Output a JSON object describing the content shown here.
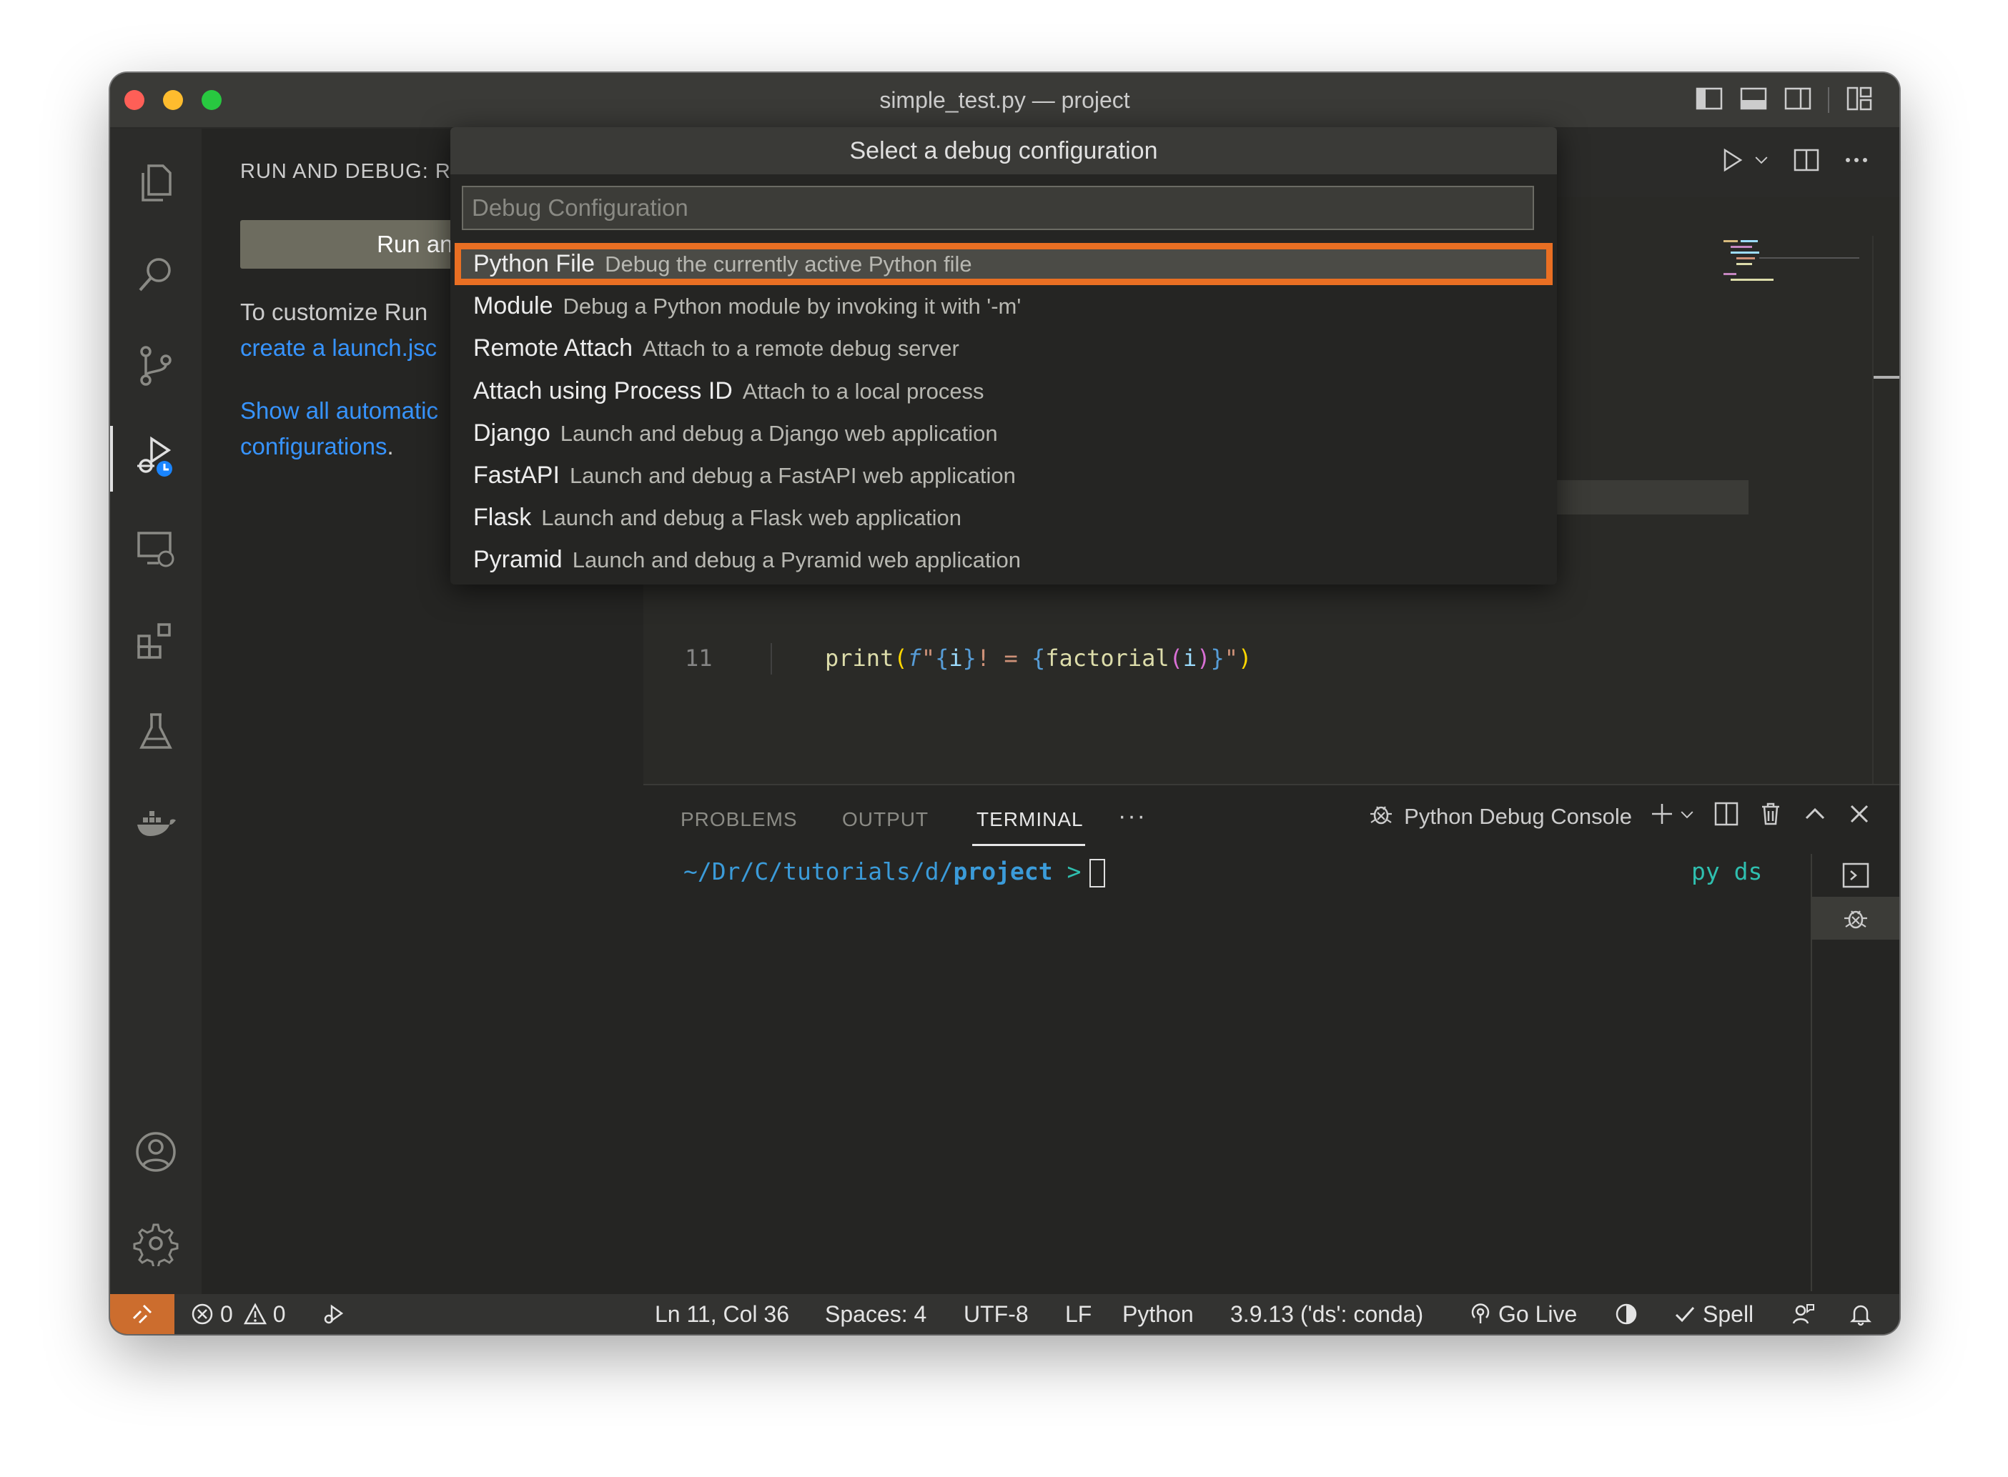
{
  "window": {
    "title": "simple_test.py — project"
  },
  "sidebar": {
    "title": "RUN AND DEBUG: RU",
    "run_button": "Run and D",
    "text_prefix": "To customize Run",
    "link_launch": "create a launch.jsc",
    "link_show": "Show all automatic",
    "link_show_2": "configurations",
    "period": "."
  },
  "quick_pick": {
    "title": "Select a debug configuration",
    "placeholder": "Debug Configuration",
    "items": [
      {
        "label": "Python File",
        "description": "Debug the currently active Python file",
        "selected": true
      },
      {
        "label": "Module",
        "description": "Debug a Python module by invoking it with '-m'"
      },
      {
        "label": "Remote Attach",
        "description": "Attach to a remote debug server"
      },
      {
        "label": "Attach using Process ID",
        "description": "Attach to a local process"
      },
      {
        "label": "Django",
        "description": "Launch and debug a Django web application"
      },
      {
        "label": "FastAPI",
        "description": "Launch and debug a FastAPI web application"
      },
      {
        "label": "Flask",
        "description": "Launch and debug a Flask web application"
      },
      {
        "label": "Pyramid",
        "description": "Launch and debug a Pyramid web application"
      }
    ]
  },
  "editor": {
    "line_number": "11",
    "code": {
      "print": "print",
      "paren_open": "(",
      "f": "f",
      "quote": "\"",
      "brace_open": "{",
      "var_i": "i",
      "brace_close": "}",
      "literal": "! = ",
      "factorial": "factorial",
      "inner_open": "(",
      "inner_close": ")",
      "paren_close": ")"
    }
  },
  "panel": {
    "tabs": [
      "PROBLEMS",
      "OUTPUT",
      "TERMINAL"
    ],
    "more": "···",
    "console_name": "Python Debug Console",
    "terminal": {
      "path": "~/Dr/C/tutorials/d/",
      "folder": "project",
      "prompt": " >",
      "right": "py ds"
    }
  },
  "statusbar": {
    "errors": "0",
    "warnings": "0",
    "position": "Ln 11, Col 36",
    "spaces": "Spaces: 4",
    "encoding": "UTF-8",
    "eol": "LF",
    "language": "Python",
    "interpreter": "3.9.13 ('ds': conda)",
    "go_live": "Go Live",
    "spell": "Spell"
  },
  "colors": {
    "accent": "#e96f23",
    "link": "#3794ff",
    "remote": "#cc6d2e"
  }
}
